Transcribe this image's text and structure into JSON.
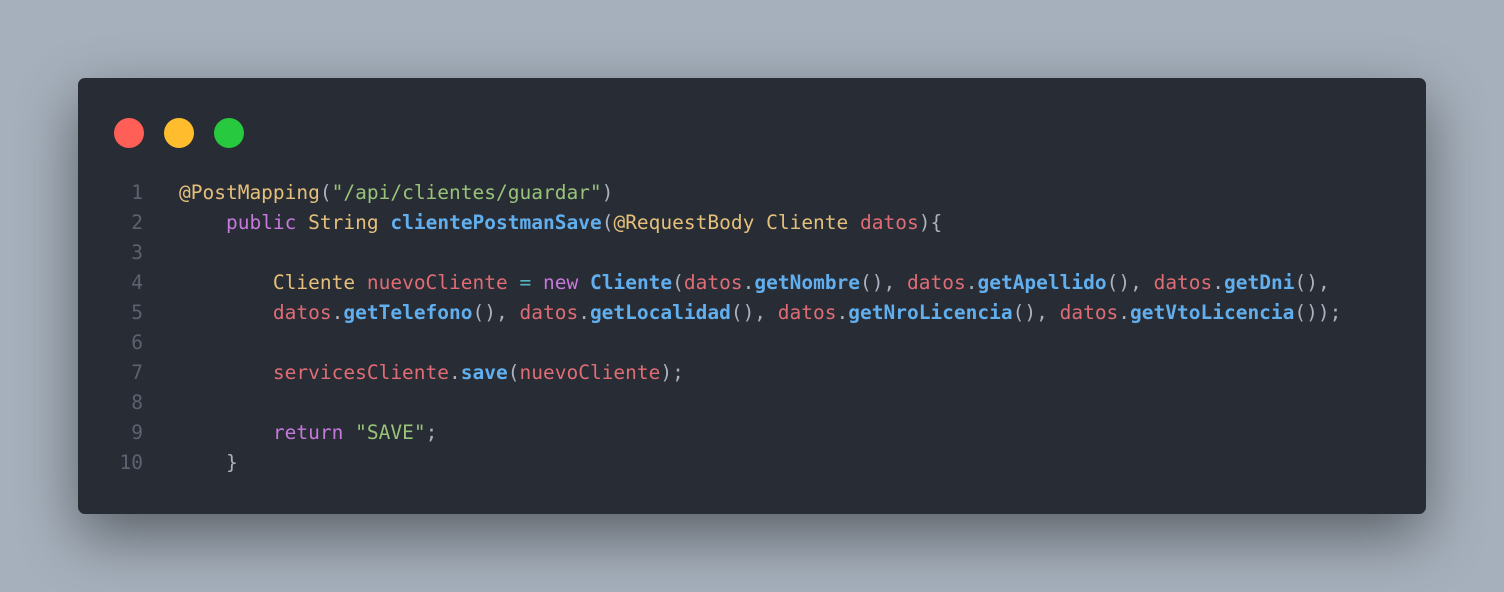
{
  "window": {
    "controls": {
      "close_color": "#ff5f56",
      "minimize_color": "#ffbd2e",
      "maximize_color": "#27c93f"
    }
  },
  "code": {
    "language": "java",
    "lines": [
      {
        "number": "1",
        "tokens": [
          {
            "text": "@PostMapping",
            "kind": "annotation"
          },
          {
            "text": "(",
            "kind": "plain"
          },
          {
            "text": "\"/api/clientes/guardar\"",
            "kind": "string"
          },
          {
            "text": ")",
            "kind": "plain"
          }
        ]
      },
      {
        "number": "2",
        "tokens": [
          {
            "text": "    ",
            "kind": "plain"
          },
          {
            "text": "public",
            "kind": "keyword"
          },
          {
            "text": " ",
            "kind": "plain"
          },
          {
            "text": "String",
            "kind": "type"
          },
          {
            "text": " ",
            "kind": "plain"
          },
          {
            "text": "clientePostmanSave",
            "kind": "function"
          },
          {
            "text": "(",
            "kind": "plain"
          },
          {
            "text": "@RequestBody",
            "kind": "annotation"
          },
          {
            "text": " ",
            "kind": "plain"
          },
          {
            "text": "Cliente",
            "kind": "type"
          },
          {
            "text": " ",
            "kind": "plain"
          },
          {
            "text": "datos",
            "kind": "variable"
          },
          {
            "text": "){",
            "kind": "plain"
          }
        ]
      },
      {
        "number": "3",
        "tokens": []
      },
      {
        "number": "4",
        "tokens": [
          {
            "text": "        ",
            "kind": "plain"
          },
          {
            "text": "Cliente",
            "kind": "type"
          },
          {
            "text": " ",
            "kind": "plain"
          },
          {
            "text": "nuevoCliente",
            "kind": "variable"
          },
          {
            "text": " ",
            "kind": "plain"
          },
          {
            "text": "=",
            "kind": "operator"
          },
          {
            "text": " ",
            "kind": "plain"
          },
          {
            "text": "new",
            "kind": "keyword"
          },
          {
            "text": " ",
            "kind": "plain"
          },
          {
            "text": "Cliente",
            "kind": "function"
          },
          {
            "text": "(",
            "kind": "plain"
          },
          {
            "text": "datos",
            "kind": "variable"
          },
          {
            "text": ".",
            "kind": "plain"
          },
          {
            "text": "getNombre",
            "kind": "function"
          },
          {
            "text": "(), ",
            "kind": "plain"
          },
          {
            "text": "datos",
            "kind": "variable"
          },
          {
            "text": ".",
            "kind": "plain"
          },
          {
            "text": "getApellido",
            "kind": "function"
          },
          {
            "text": "(), ",
            "kind": "plain"
          },
          {
            "text": "datos",
            "kind": "variable"
          },
          {
            "text": ".",
            "kind": "plain"
          },
          {
            "text": "getDni",
            "kind": "function"
          },
          {
            "text": "(),",
            "kind": "plain"
          }
        ]
      },
      {
        "number": "5",
        "tokens": [
          {
            "text": "        ",
            "kind": "plain"
          },
          {
            "text": "datos",
            "kind": "variable"
          },
          {
            "text": ".",
            "kind": "plain"
          },
          {
            "text": "getTelefono",
            "kind": "function"
          },
          {
            "text": "(), ",
            "kind": "plain"
          },
          {
            "text": "datos",
            "kind": "variable"
          },
          {
            "text": ".",
            "kind": "plain"
          },
          {
            "text": "getLocalidad",
            "kind": "function"
          },
          {
            "text": "(), ",
            "kind": "plain"
          },
          {
            "text": "datos",
            "kind": "variable"
          },
          {
            "text": ".",
            "kind": "plain"
          },
          {
            "text": "getNroLicencia",
            "kind": "function"
          },
          {
            "text": "(), ",
            "kind": "plain"
          },
          {
            "text": "datos",
            "kind": "variable"
          },
          {
            "text": ".",
            "kind": "plain"
          },
          {
            "text": "getVtoLicencia",
            "kind": "function"
          },
          {
            "text": "());",
            "kind": "plain"
          }
        ]
      },
      {
        "number": "6",
        "tokens": []
      },
      {
        "number": "7",
        "tokens": [
          {
            "text": "        ",
            "kind": "plain"
          },
          {
            "text": "servicesCliente",
            "kind": "variable"
          },
          {
            "text": ".",
            "kind": "plain"
          },
          {
            "text": "save",
            "kind": "function"
          },
          {
            "text": "(",
            "kind": "plain"
          },
          {
            "text": "nuevoCliente",
            "kind": "variable"
          },
          {
            "text": ");",
            "kind": "plain"
          }
        ]
      },
      {
        "number": "8",
        "tokens": []
      },
      {
        "number": "9",
        "tokens": [
          {
            "text": "        ",
            "kind": "plain"
          },
          {
            "text": "return",
            "kind": "keyword"
          },
          {
            "text": " ",
            "kind": "plain"
          },
          {
            "text": "\"SAVE\"",
            "kind": "string"
          },
          {
            "text": ";",
            "kind": "plain"
          }
        ]
      },
      {
        "number": "10",
        "tokens": [
          {
            "text": "    ",
            "kind": "plain"
          },
          {
            "text": "}",
            "kind": "plain"
          }
        ]
      }
    ]
  }
}
